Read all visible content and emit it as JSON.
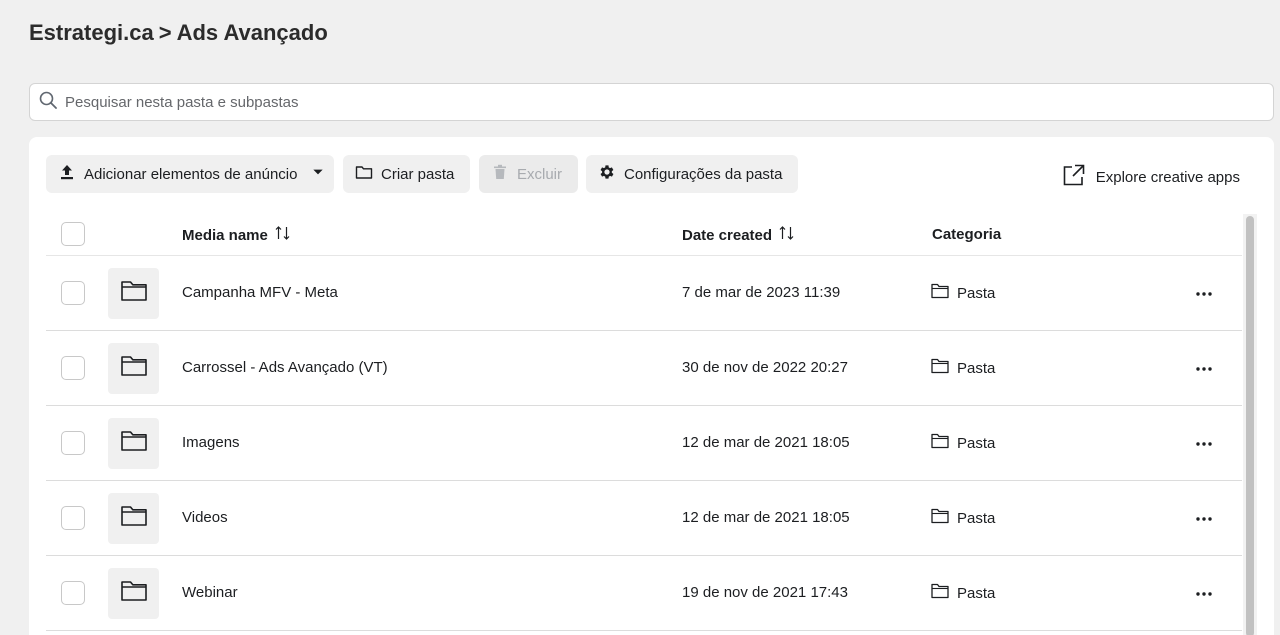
{
  "breadcrumb": {
    "root": "Estrategi.ca",
    "separator": ">",
    "current": "Ads Avançado"
  },
  "search": {
    "placeholder": "Pesquisar nesta pasta e subpastas",
    "value": ""
  },
  "toolbar": {
    "add_label": "Adicionar elementos de anúncio",
    "create_folder_label": "Criar pasta",
    "delete_label": "Excluir",
    "settings_label": "Configurações da pasta",
    "explore_label": "Explore creative apps"
  },
  "table": {
    "columns": {
      "name": "Media name",
      "date": "Date created",
      "category": "Categoria"
    },
    "rows": [
      {
        "name": "Campanha MFV - Meta",
        "date": "7 de mar de 2023 11:39",
        "category": "Pasta"
      },
      {
        "name": "Carrossel - Ads Avançado (VT)",
        "date": "30 de nov de 2022 20:27",
        "category": "Pasta"
      },
      {
        "name": "Imagens",
        "date": "12 de mar de 2021 18:05",
        "category": "Pasta"
      },
      {
        "name": "Videos",
        "date": "12 de mar de 2021 18:05",
        "category": "Pasta"
      },
      {
        "name": "Webinar",
        "date": "19 de nov de 2021 17:43",
        "category": "Pasta"
      }
    ]
  },
  "icons": {
    "search": "search-icon",
    "upload": "upload-icon",
    "dropdown": "caret-down-icon",
    "folder": "folder-icon",
    "trash": "trash-icon",
    "gear": "gear-icon",
    "external": "external-link-icon",
    "sort": "sort-icon",
    "more": "more-horizontal-icon"
  },
  "colors": {
    "page_bg": "#f0f0f0",
    "button_bg": "#f0f0f0",
    "text": "#1c1e21",
    "disabled_text": "#a8abaf"
  }
}
